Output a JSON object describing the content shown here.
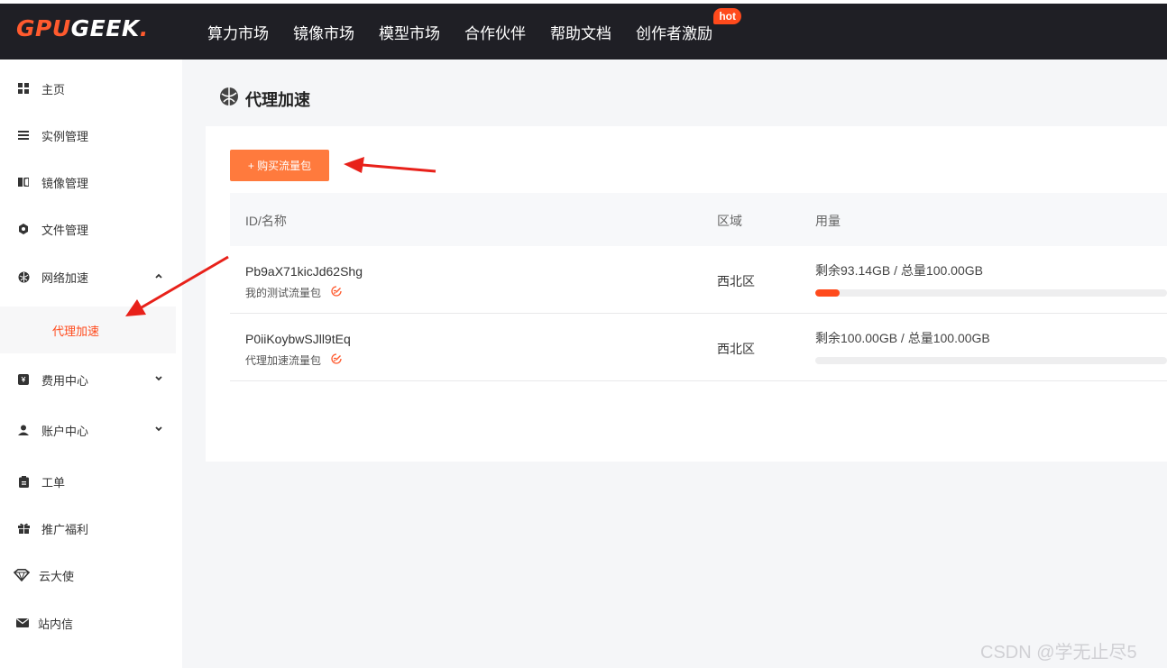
{
  "logo": {
    "part1": "GPU",
    "part2": "GEEK",
    "part3": "."
  },
  "nav": {
    "items": [
      "算力市场",
      "镜像市场",
      "模型市场",
      "合作伙伴",
      "帮助文档",
      "创作者激励"
    ],
    "hot_badge": "hot"
  },
  "sidebar": {
    "items": [
      {
        "label": "主页",
        "icon": "grid-icon"
      },
      {
        "label": "实例管理",
        "icon": "list-icon"
      },
      {
        "label": "镜像管理",
        "icon": "image-icon"
      },
      {
        "label": "文件管理",
        "icon": "hexagon-icon"
      },
      {
        "label": "网络加速",
        "icon": "network-icon",
        "expanded": true
      },
      {
        "label": "费用中心",
        "icon": "wallet-icon",
        "expanded": false
      },
      {
        "label": "账户中心",
        "icon": "user-icon",
        "expanded": false
      },
      {
        "label": "工单",
        "icon": "clipboard-icon"
      },
      {
        "label": "推广福利",
        "icon": "gift-icon"
      },
      {
        "label": "云大使",
        "icon": "diamond-icon"
      },
      {
        "label": "站内信",
        "icon": "mail-icon"
      }
    ],
    "sub_item": "代理加速"
  },
  "main": {
    "title": "代理加速",
    "buy_button": "+ 购买流量包",
    "table": {
      "headers": [
        "ID/名称",
        "区域",
        "用量"
      ],
      "rows": [
        {
          "id": "Pb9aX71kicJd62Shg",
          "name": "我的测试流量包",
          "region": "西北区",
          "usage": "剩余93.14GB / 总量100.00GB",
          "used_fraction": 0.0686
        },
        {
          "id": "P0iiKoybwSJll9tEq",
          "name": "代理加速流量包",
          "region": "西北区",
          "usage": "剩余100.00GB / 总量100.00GB",
          "used_fraction": 0.0
        }
      ]
    }
  },
  "watermark": "CSDN @学无止尽5",
  "colors": {
    "accent": "#ff4a1c",
    "button": "#ff7a3d",
    "topbar": "#1f1f25"
  }
}
